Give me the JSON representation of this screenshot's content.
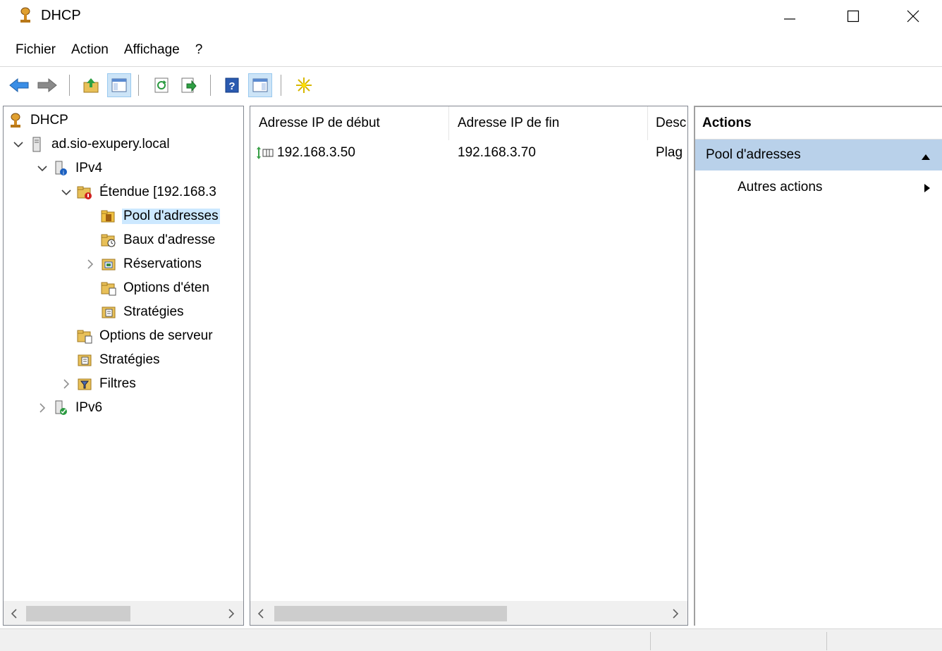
{
  "window": {
    "title": "DHCP"
  },
  "menu": [
    "Fichier",
    "Action",
    "Affichage",
    "?"
  ],
  "tree": [
    {
      "label": "DHCP",
      "level": 0,
      "expander": ""
    },
    {
      "label": "ad.sio-exupery.local",
      "level": 1,
      "expander": "expanded"
    },
    {
      "label": "IPv4",
      "level": 2,
      "expander": "expanded"
    },
    {
      "label": "Étendue [192.168.3",
      "level": 3,
      "expander": "expanded"
    },
    {
      "label": "Pool d'adresses",
      "level": 4,
      "expander": "",
      "selected": true
    },
    {
      "label": "Baux d'adresse",
      "level": 4,
      "expander": ""
    },
    {
      "label": "Réservations",
      "level": 4,
      "expander": "collapsed"
    },
    {
      "label": "Options d'éten",
      "level": 4,
      "expander": ""
    },
    {
      "label": "Stratégies",
      "level": 4,
      "expander": ""
    },
    {
      "label": "Options de serveur",
      "level": 3,
      "expander": ""
    },
    {
      "label": "Stratégies",
      "level": 3,
      "expander": ""
    },
    {
      "label": "Filtres",
      "level": 3,
      "expander": "collapsed"
    },
    {
      "label": "IPv6",
      "level": 2,
      "expander": "collapsed"
    }
  ],
  "list": {
    "columns": [
      "Adresse IP de début",
      "Adresse IP de fin",
      "Desc"
    ],
    "rows": [
      {
        "start": "192.168.3.50",
        "end": "192.168.3.70",
        "desc": "Plag"
      }
    ]
  },
  "actions": {
    "header": "Actions",
    "group": "Pool d'adresses",
    "item": "Autres actions"
  },
  "colors": {
    "selection": "#cce8ff",
    "action_group": "#b9d1ea",
    "toolbar_pressed": "#cce4f7"
  }
}
